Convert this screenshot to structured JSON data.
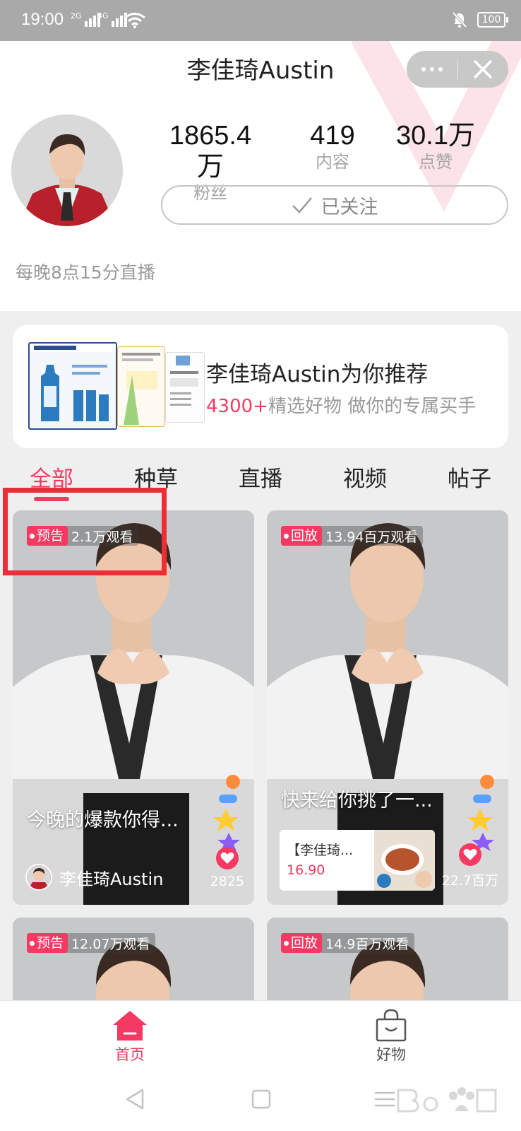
{
  "status_bar": {
    "time": "19:00",
    "signal_1_label": "2G",
    "signal_2_label": "4G",
    "battery": "100"
  },
  "header": {
    "title": "李佳琦Austin",
    "stats": [
      {
        "value": "1865.4万",
        "label": "粉丝"
      },
      {
        "value": "419",
        "label": "内容"
      },
      {
        "value": "30.1万",
        "label": "点赞"
      }
    ],
    "follow_label": "已关注",
    "bio": "每晚8点15分直播"
  },
  "recommend": {
    "title": "李佳琦Austin为你推荐",
    "highlight": "4300+",
    "subtitle": "精选好物  做你的专属买手"
  },
  "tabs": [
    {
      "label": "全部",
      "active": true
    },
    {
      "label": "种草",
      "active": false
    },
    {
      "label": "直播",
      "active": false
    },
    {
      "label": "视频",
      "active": false
    },
    {
      "label": "帖子",
      "active": false
    }
  ],
  "feed": [
    {
      "tag": "预告",
      "views": "2.1万观看",
      "caption": "今晚的爆款你得...",
      "author": "李佳琦Austin",
      "likes": "2825"
    },
    {
      "tag": "回放",
      "views": "13.94百万观看",
      "caption": "快来给你挑了一...",
      "goods_name": "【李佳琦...",
      "goods_price": "16.90",
      "likes": "22.7百万"
    },
    {
      "tag": "预告",
      "views": "12.07万观看"
    },
    {
      "tag": "回放",
      "views": "14.9百万观看"
    }
  ],
  "bottom_nav": [
    {
      "label": "首页",
      "active": true
    },
    {
      "label": "好物",
      "active": false
    }
  ],
  "colors": {
    "accent": "#f43a63",
    "highlight_box": "#ee2d36",
    "status_bar": "#a9a9a9"
  },
  "icons": [
    "signal-icon",
    "wifi-icon",
    "mute-icon",
    "battery-icon",
    "more-icon",
    "close-icon",
    "check-icon",
    "heart-icon",
    "home-icon",
    "bag-icon",
    "back-icon",
    "square-icon",
    "menu-icon"
  ]
}
